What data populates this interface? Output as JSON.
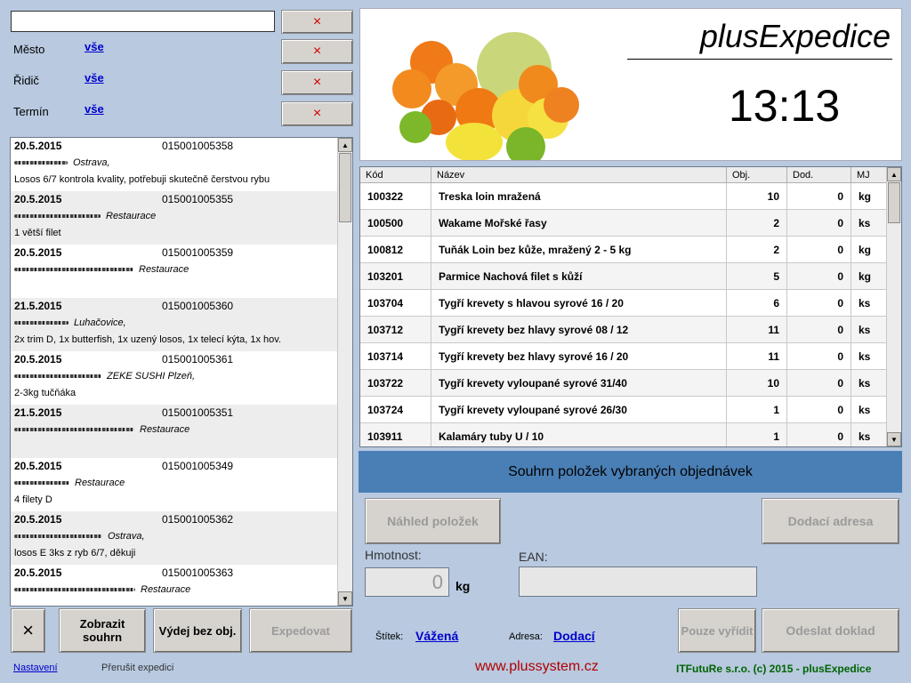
{
  "filters": {
    "search_value": "",
    "rows": [
      {
        "label": "Město",
        "value": "vše"
      },
      {
        "label": "Řidič",
        "value": "vše"
      },
      {
        "label": "Termín",
        "value": "vše"
      }
    ],
    "clear_symbol": "×"
  },
  "orders": [
    {
      "date": "20.5.2015",
      "number": "015001005358",
      "line1": "Ostrava,",
      "line2": "Losos 6/7 kontrola kvality, potřebuji skutečně čerstvou rybu"
    },
    {
      "date": "20.5.2015",
      "number": "015001005355",
      "line1": "Restaurace",
      "line2": "1 větší filet"
    },
    {
      "date": "20.5.2015",
      "number": "015001005359",
      "line1": "Restaurace",
      "line2": ""
    },
    {
      "date": "21.5.2015",
      "number": "015001005360",
      "line1": "Luhačovice,",
      "line2": "2x trim D, 1x butterfish, 1x uzený losos, 1x telecí kýta, 1x hov."
    },
    {
      "date": "20.5.2015",
      "number": "015001005361",
      "line1": "ZEKE SUSHI Plzeň,",
      "line2": "2-3kg tučňáka"
    },
    {
      "date": "21.5.2015",
      "number": "015001005351",
      "line1": "Restaurace",
      "line2": ""
    },
    {
      "date": "20.5.2015",
      "number": "015001005349",
      "line1": "Restaurace",
      "line2": "4 filety D"
    },
    {
      "date": "20.5.2015",
      "number": "015001005362",
      "line1": "Ostrava,",
      "line2": "losos E 3ks z ryb 6/7, děkuji"
    },
    {
      "date": "20.5.2015",
      "number": "015001005363",
      "line1": "Restaurace",
      "line2": ""
    }
  ],
  "left_buttons": {
    "close": "×",
    "show_summary": "Zobrazit souhrn",
    "issue_without_order": "Výdej bez obj.",
    "expedite": "Expedovat"
  },
  "footer_left": {
    "settings": "Nastavení",
    "interrupt": "Přerušit expedici"
  },
  "brand": {
    "title": "plusExpedice",
    "clock": "13:13"
  },
  "items_table": {
    "headers": {
      "code": "Kód",
      "name": "Název",
      "ordered": "Obj.",
      "delivered": "Dod.",
      "unit": "MJ"
    },
    "rows": [
      {
        "code": "100322",
        "name": "Treska loin mražená",
        "ordered": "10",
        "delivered": "0",
        "unit": "kg"
      },
      {
        "code": "100500",
        "name": "Wakame  Mořské řasy",
        "ordered": "2",
        "delivered": "0",
        "unit": "ks"
      },
      {
        "code": "100812",
        "name": "Tuňák Loin bez kůže, mražený 2 - 5 kg",
        "ordered": "2",
        "delivered": "0",
        "unit": "kg"
      },
      {
        "code": "103201",
        "name": "Parmice Nachová filet s kůží",
        "ordered": "5",
        "delivered": "0",
        "unit": "kg"
      },
      {
        "code": "103704",
        "name": "Tygří krevety s hlavou syrové 16 / 20",
        "ordered": "6",
        "delivered": "0",
        "unit": "ks"
      },
      {
        "code": "103712",
        "name": "Tygří krevety bez hlavy syrové 08 / 12",
        "ordered": "11",
        "delivered": "0",
        "unit": "ks"
      },
      {
        "code": "103714",
        "name": "Tygří krevety bez hlavy syrové 16 / 20",
        "ordered": "11",
        "delivered": "0",
        "unit": "ks"
      },
      {
        "code": "103722",
        "name": "Tygří krevety vyloupané syrové 31/40",
        "ordered": "10",
        "delivered": "0",
        "unit": "ks"
      },
      {
        "code": "103724",
        "name": "Tygří krevety vyloupané syrové 26/30",
        "ordered": "1",
        "delivered": "0",
        "unit": "ks"
      },
      {
        "code": "103911",
        "name": "Kalamáry tuby U / 10",
        "ordered": "1",
        "delivered": "0",
        "unit": "ks"
      }
    ]
  },
  "summary_banner": "Souhrn položek vybraných objednávek",
  "right_panel": {
    "preview_items": "Náhled položek",
    "delivery_address": "Dodací adresa",
    "weight_label": "Hmotnost:",
    "weight_value": "0",
    "weight_unit": "kg",
    "ean_label": "EAN:",
    "ean_value": "",
    "label_caption": "Štítek:",
    "label_value": "Vážená",
    "address_caption": "Adresa:",
    "address_value": "Dodací",
    "use_button": "Pouze vyřídit",
    "send_document": "Odeslat doklad"
  },
  "footer_right": {
    "website": "www.plussystem.cz",
    "copyright": "ITFutuRe s.r.o. (c) 2015 - plusExpedice"
  },
  "colors": {
    "background": "#b8c9e0",
    "banner": "#4a7fb5",
    "website": "#b00000",
    "copyright": "#006400",
    "link": "#0000cc"
  }
}
